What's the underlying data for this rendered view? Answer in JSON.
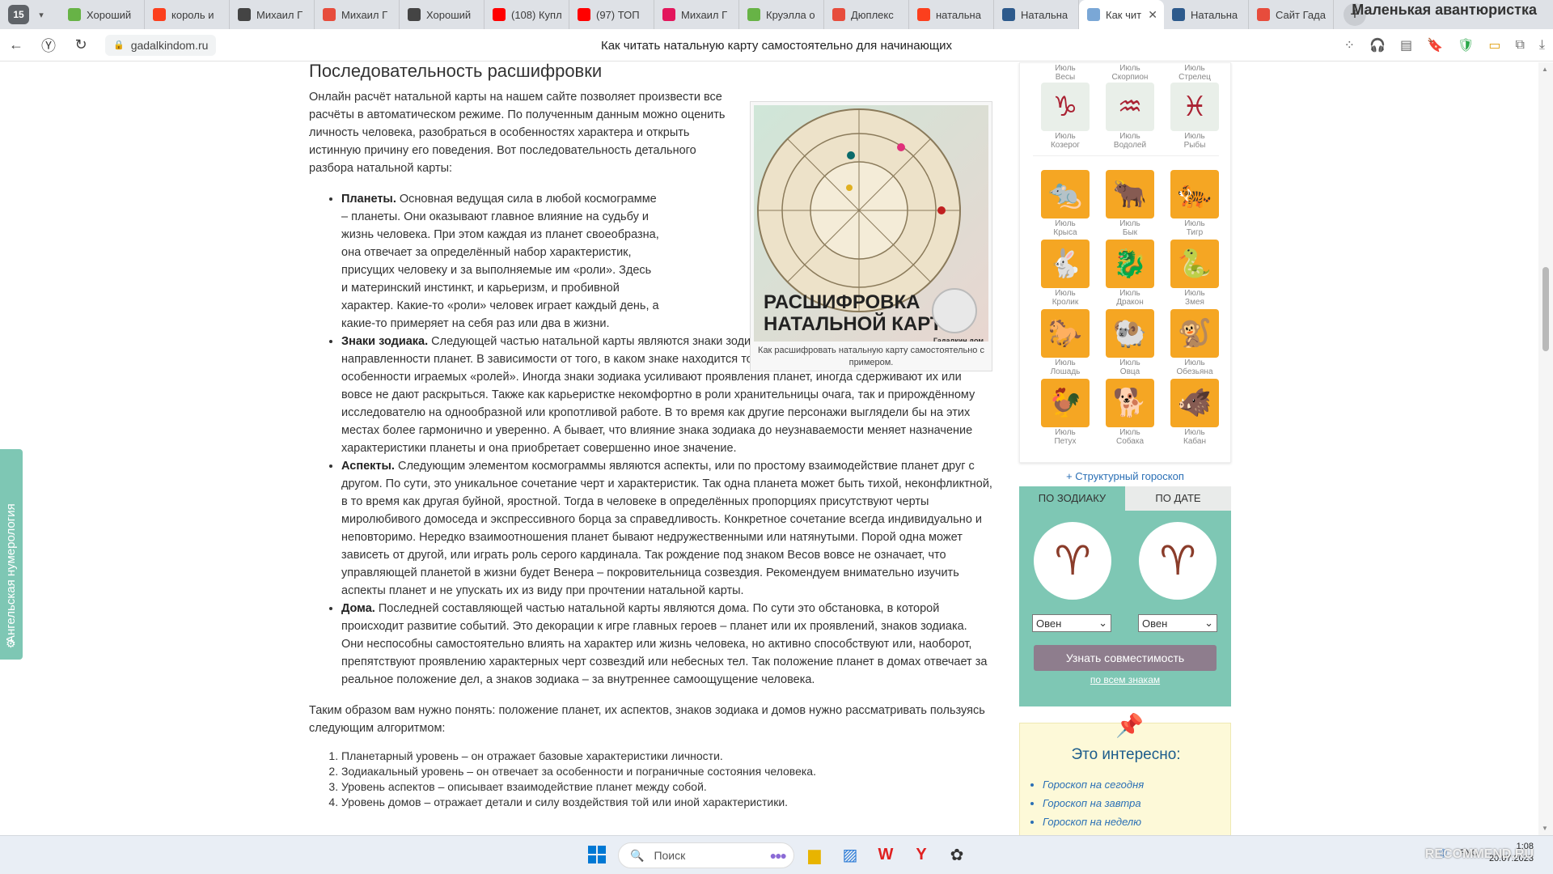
{
  "browser": {
    "tab_count": "15",
    "tabs": [
      {
        "label": "Хороший",
        "color": "#67b346"
      },
      {
        "label": "король и",
        "color": "#fc3f1d"
      },
      {
        "label": "Михаил Г",
        "color": "#444444"
      },
      {
        "label": "Михаил Г",
        "color": "#e74c3c"
      },
      {
        "label": "Хороший",
        "color": "#444444"
      },
      {
        "label": "(108) Купл",
        "color": "#ff0000"
      },
      {
        "label": "(97) ТОП",
        "color": "#ff0000"
      },
      {
        "label": "Михаил Г",
        "color": "#e3165c"
      },
      {
        "label": "Круэлла о",
        "color": "#67b346"
      },
      {
        "label": "Дюплекс",
        "color": "#e74c3c"
      },
      {
        "label": "натальна",
        "color": "#fc3f1d"
      },
      {
        "label": "Натальна",
        "color": "#2d5a8c"
      },
      {
        "label": "Как чит",
        "color": "#7aa7d6",
        "active": true
      },
      {
        "label": "Натальна",
        "color": "#2d5a8c"
      },
      {
        "label": "Сайт Гада",
        "color": "#e74c3c"
      }
    ],
    "window_title": "Маленькая авантюристка",
    "url": "gadalkindom.ru",
    "page_title": "Как читать натальную карту самостоятельно для начинающих"
  },
  "article": {
    "heading": "Последовательность расшифровки",
    "intro": "Онлайн расчёт натальной карты на нашем сайте позволяет произвести все расчёты в автоматическом режиме. По полученным данным можно оценить личность человека, разобраться в особенностях характера и открыть истинную причину его поведения. Вот последовательность детального разбора натальной карты:",
    "figure": {
      "title_line1": "РАСШИФРОВКА",
      "title_line2": "НАТАЛЬНОЙ КАРТЫ",
      "logo_text": "Гадалкин дом",
      "caption": "Как расшифровать натальную карту самостоятельно с примером."
    },
    "points": [
      {
        "term": "Планеты.",
        "text": " Основная ведущая сила в любой космограмме – планеты. Они оказывают главное влияние на судьбу и жизнь человека. При этом каждая из планет своеобразна, она отвечает за определённый набор характеристик, присущих человеку и за выполняемые им «роли». Здесь и материнский инстинкт, и карьеризм, и пробивной характер. Какие-то «роли» человек играет каждый день, а какие-то примеряет на себя раз или два в жизни."
      },
      {
        "term": "Знаки зодиака.",
        "text": " Следующей частью натальной карты являются знаки зодиака. Это своеобразный способ выражения направленности планет. В зависимости от того, в каком знаке находится то ли иное космическое тело, меняются и особенности играемых «ролей». Иногда знаки зодиака усиливают проявления планет, иногда сдерживают их или вовсе не дают раскрыться. Также как карьеристке некомфортно в роли хранительницы очага, так и прирождённому исследователю на однообразной или кропотливой работе. В то время как другие персонажи выглядели бы на этих местах более гармонично и уверенно. А бывает, что влияние знака зодиака до неузнаваемости меняет назначение характеристики планеты и она приобретает совершенно иное значение."
      },
      {
        "term": "Аспекты.",
        "text": " Следующим элементом космограммы являются аспекты, или по простому взаимодействие планет друг с другом. По сути, это уникальное сочетание черт и характеристик. Так одна планета может быть тихой, неконфликтной, в то время как другая буйной, яростной. Тогда в человеке в определённых пропорциях присутствуют черты миролюбивого домоседа и экспрессивного борца за справедливость. Конкретное сочетание всегда индивидуально и неповторимо. Нередко взаимоотношения планет бывают недружественными или натянутыми. Порой одна может зависеть от другой, или играть роль серого кардинала. Так рождение под знаком Весов вовсе не означает, что управляющей планетой в жизни будет Венера – покровительница созвездия. Рекомендуем внимательно изучить аспекты планет и не упускать их из виду при прочтении натальной карты."
      },
      {
        "term": "Дома.",
        "text": " Последней составляющей частью натальной карты являются дома. По сути это обстановка, в которой происходит развитие событий. Это декорации к игре главных героев – планет или их проявлений, знаков зодиака. Они неспособны самостоятельно влиять на характер или жизнь человека, но активно способствуют или, наоборот, препятствуют проявлению характерных черт созвездий или небесных тел. Так положение планет в домах отвечает за реальное положение дел, а знаков зодиака – за внутреннее самоощущение человека."
      }
    ],
    "summary": "Таким образом вам нужно понять: положение планет, их аспектов, знаков зодиака и домов нужно рассматривать пользуясь следующим алгоритмом:",
    "levels": [
      "Планетарный уровень – он отражает базовые характеристики личности.",
      "Зодиакальный уровень – он отвечает за особенности и пограничные состояния человека.",
      "Уровень аспектов – описывает взаимодействие планет между собой.",
      "Уровень домов – отражает детали и силу воздействия той или иной характеристики."
    ]
  },
  "sidebar": {
    "western_top": [
      {
        "month": "Июль",
        "sign": "Весы"
      },
      {
        "month": "Июль",
        "sign": "Скорпион"
      },
      {
        "month": "Июль",
        "sign": "Стрелец"
      }
    ],
    "western_bottom": [
      {
        "month": "Июль",
        "sign": "Козерог",
        "glyph": "♑"
      },
      {
        "month": "Июль",
        "sign": "Водолей",
        "glyph": "♒"
      },
      {
        "month": "Июль",
        "sign": "Рыбы",
        "glyph": "♓"
      }
    ],
    "eastern": [
      {
        "month": "Июль",
        "sign": "Крыса",
        "glyph": "🐀"
      },
      {
        "month": "Июль",
        "sign": "Бык",
        "glyph": "🐂"
      },
      {
        "month": "Июль",
        "sign": "Тигр",
        "glyph": "🐅"
      },
      {
        "month": "Июль",
        "sign": "Кролик",
        "glyph": "🐇"
      },
      {
        "month": "Июль",
        "sign": "Дракон",
        "glyph": "🐉"
      },
      {
        "month": "Июль",
        "sign": "Змея",
        "glyph": "🐍"
      },
      {
        "month": "Июль",
        "sign": "Лошадь",
        "glyph": "🐎"
      },
      {
        "month": "Июль",
        "sign": "Овца",
        "glyph": "🐏"
      },
      {
        "month": "Июль",
        "sign": "Обезьяна",
        "glyph": "🐒"
      },
      {
        "month": "Июль",
        "sign": "Петух",
        "glyph": "🐓"
      },
      {
        "month": "Июль",
        "sign": "Собака",
        "glyph": "🐕"
      },
      {
        "month": "Июль",
        "sign": "Кабан",
        "glyph": "🐗"
      }
    ],
    "struct_link": "+ Структурный гороскоп",
    "compat": {
      "tab_zodiac": "ПО ЗОДИАКУ",
      "tab_date": "ПО ДАТЕ",
      "left_value": "Овен",
      "right_value": "Овен",
      "button": "Узнать совместимость",
      "link": "по всем знакам"
    },
    "interest": {
      "title": "Это интересно:",
      "links": [
        "Гороскоп на сегодня",
        "Гороскоп на завтра",
        "Гороскоп на неделю"
      ]
    }
  },
  "float_tab": {
    "label": "Ангельская нумерология"
  },
  "taskbar": {
    "search_placeholder": "Поиск",
    "lang": "РУС",
    "time": "1:08",
    "date": "20.07.2023",
    "watermark": "RECOMMEND.RU"
  }
}
